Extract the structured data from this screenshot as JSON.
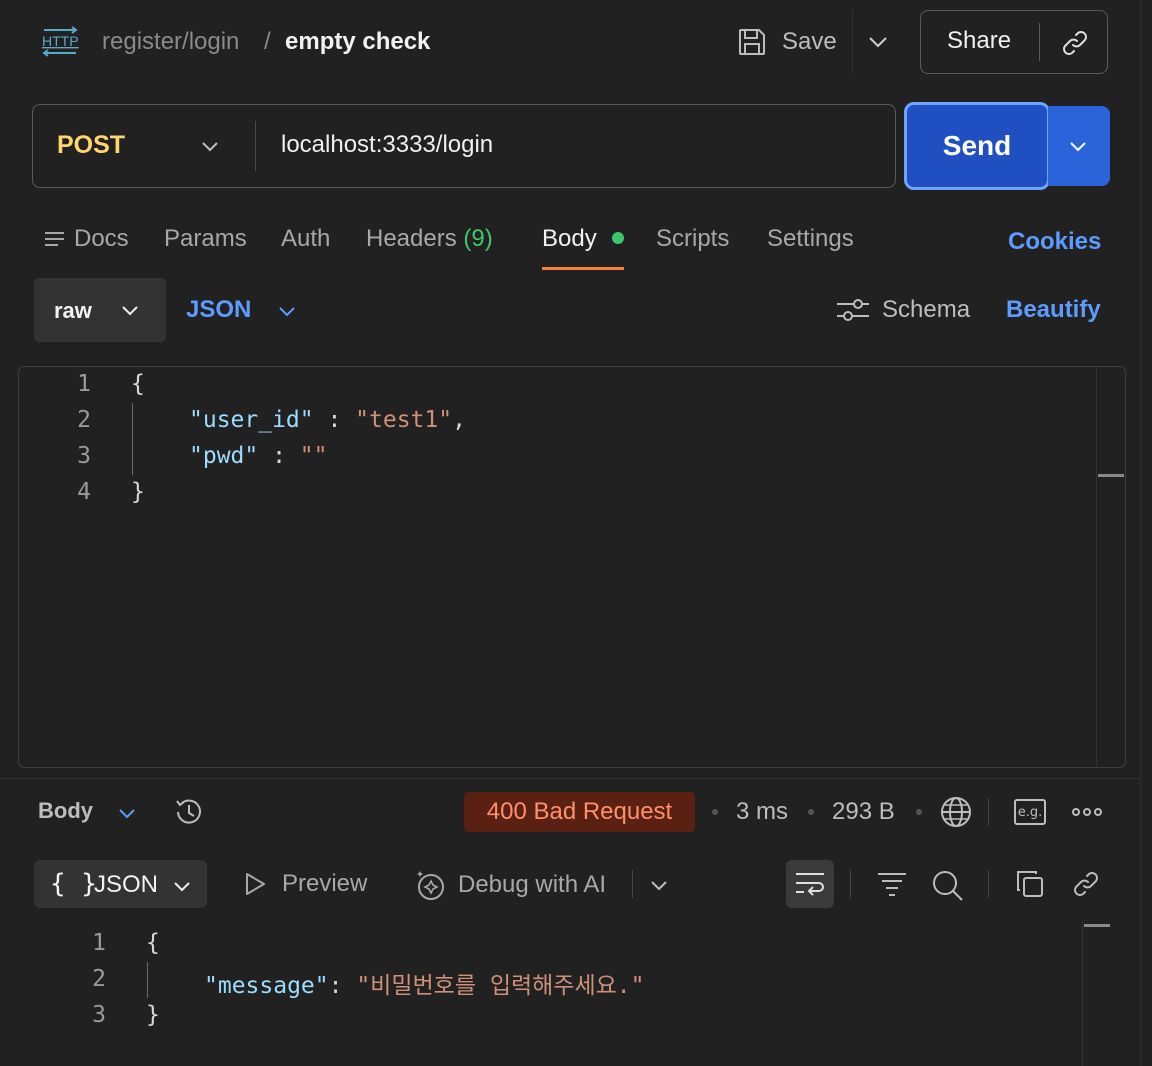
{
  "header": {
    "request_type_icon": "http-icon",
    "breadcrumb_parent": "register/login",
    "breadcrumb_separator": "/",
    "request_name": "empty check",
    "save_label": "Save",
    "share_label": "Share"
  },
  "request": {
    "method": "POST",
    "url": "localhost:3333/login",
    "send_label": "Send"
  },
  "tabs": {
    "docs": "Docs",
    "params": "Params",
    "auth": "Auth",
    "headers": "Headers",
    "headers_count": "(9)",
    "body": "Body",
    "scripts": "Scripts",
    "settings": "Settings",
    "active": "Body",
    "cookies": "Cookies"
  },
  "body_options": {
    "mode": "raw",
    "format": "JSON",
    "schema_label": "Schema",
    "beautify_label": "Beautify"
  },
  "request_body": {
    "line_numbers": [
      "1",
      "2",
      "3",
      "4"
    ],
    "open_brace": "{",
    "close_brace": "}",
    "key1": "\"user_id\"",
    "colon1": " : ",
    "value1": "\"test1\"",
    "comma1": ",",
    "key2": "\"pwd\"",
    "colon2": " : ",
    "value2": "\"\""
  },
  "response_bar": {
    "section_label": "Body",
    "status": "400 Bad Request",
    "time": "3 ms",
    "size": "293 B",
    "example_label": "e.g."
  },
  "response_toolbar": {
    "view_braces": "{ }",
    "view_format": "JSON",
    "preview_label": "Preview",
    "debug_label": "Debug with AI"
  },
  "response_body": {
    "line_numbers": [
      "1",
      "2",
      "3"
    ],
    "open_brace": "{",
    "close_brace": "}",
    "key": "\"message\"",
    "colon": ": ",
    "value": "\"비밀번호를 입력해주세요.\""
  },
  "colors": {
    "background": "#212121",
    "method": "#ffd66b",
    "accent_blue": "#5d9cff",
    "send_button": "#1f4fc0",
    "tab_indicator": "#f57c43",
    "success_dot": "#3ec66b",
    "error_badge_bg": "#5a2012",
    "error_badge_text": "#ff8f6b",
    "json_key": "#9cdcfe",
    "json_string": "#ce9178"
  }
}
